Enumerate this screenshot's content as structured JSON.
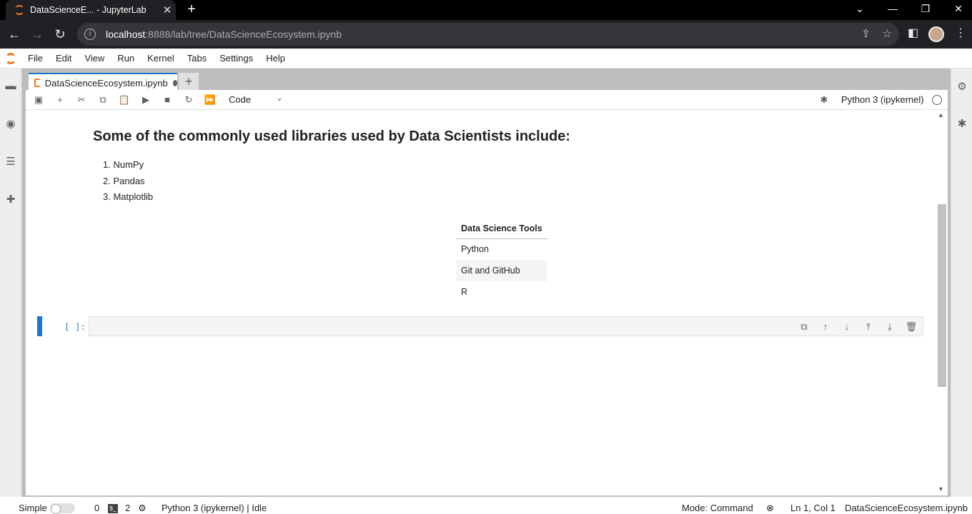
{
  "browser": {
    "tab_title": "DataScienceE... - JupyterLab",
    "tab_close": "✕",
    "new_tab": "+",
    "url_host": "localhost",
    "url_rest": ":8888/lab/tree/DataScienceEcosystem.ipynb"
  },
  "menu": {
    "items": [
      "File",
      "Edit",
      "View",
      "Run",
      "Kernel",
      "Tabs",
      "Settings",
      "Help"
    ]
  },
  "notebook_tab": {
    "label": "DataScienceEcosystem.ipynb",
    "add": "+"
  },
  "toolbar": {
    "cell_type": "Code",
    "kernel": "Python 3 (ipykernel)"
  },
  "content": {
    "heading": "Some of the commonly used libraries used by Data Scientists include:",
    "libraries": [
      "1. NumPy",
      "2. Pandas",
      "3. Matplotlib"
    ],
    "table": {
      "header": "Data Science Tools",
      "rows": [
        "Python",
        "Git and GitHub",
        "R"
      ]
    }
  },
  "code_cell": {
    "prompt": "[ ]:"
  },
  "status": {
    "mode_label": "Simple",
    "terminals_count": "0",
    "kernels_count": "2",
    "kernel_status": "Python 3 (ipykernel) | Idle",
    "mode": "Mode: Command",
    "cursor": "Ln 1, Col 1",
    "file": "DataScienceEcosystem.ipynb"
  }
}
